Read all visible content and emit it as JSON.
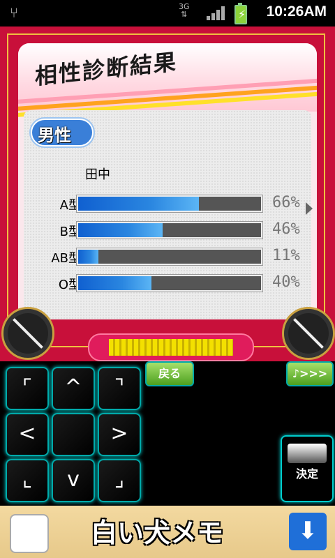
{
  "status_bar": {
    "network": "3G",
    "time": "10:26AM"
  },
  "result_panel": {
    "title": "相性診断結果",
    "gender_label": "男性",
    "name": "田中",
    "rows": [
      {
        "label": "A型",
        "percent_text": "66%",
        "value": 66
      },
      {
        "label": "B型",
        "percent_text": "46%",
        "value": 46
      },
      {
        "label": "AB型",
        "percent_text": "11%",
        "value": 11
      },
      {
        "label": "O型",
        "percent_text": "40%",
        "value": 40
      }
    ]
  },
  "controls": {
    "back_label": "戻る",
    "next_label": "♪>>>",
    "enter_label": "決定"
  },
  "ad": {
    "brand": "白い犬メモ"
  },
  "colors": {
    "frame": "#c8103a",
    "bar_fill": "#2a86e0",
    "button_green": "#4da020"
  }
}
